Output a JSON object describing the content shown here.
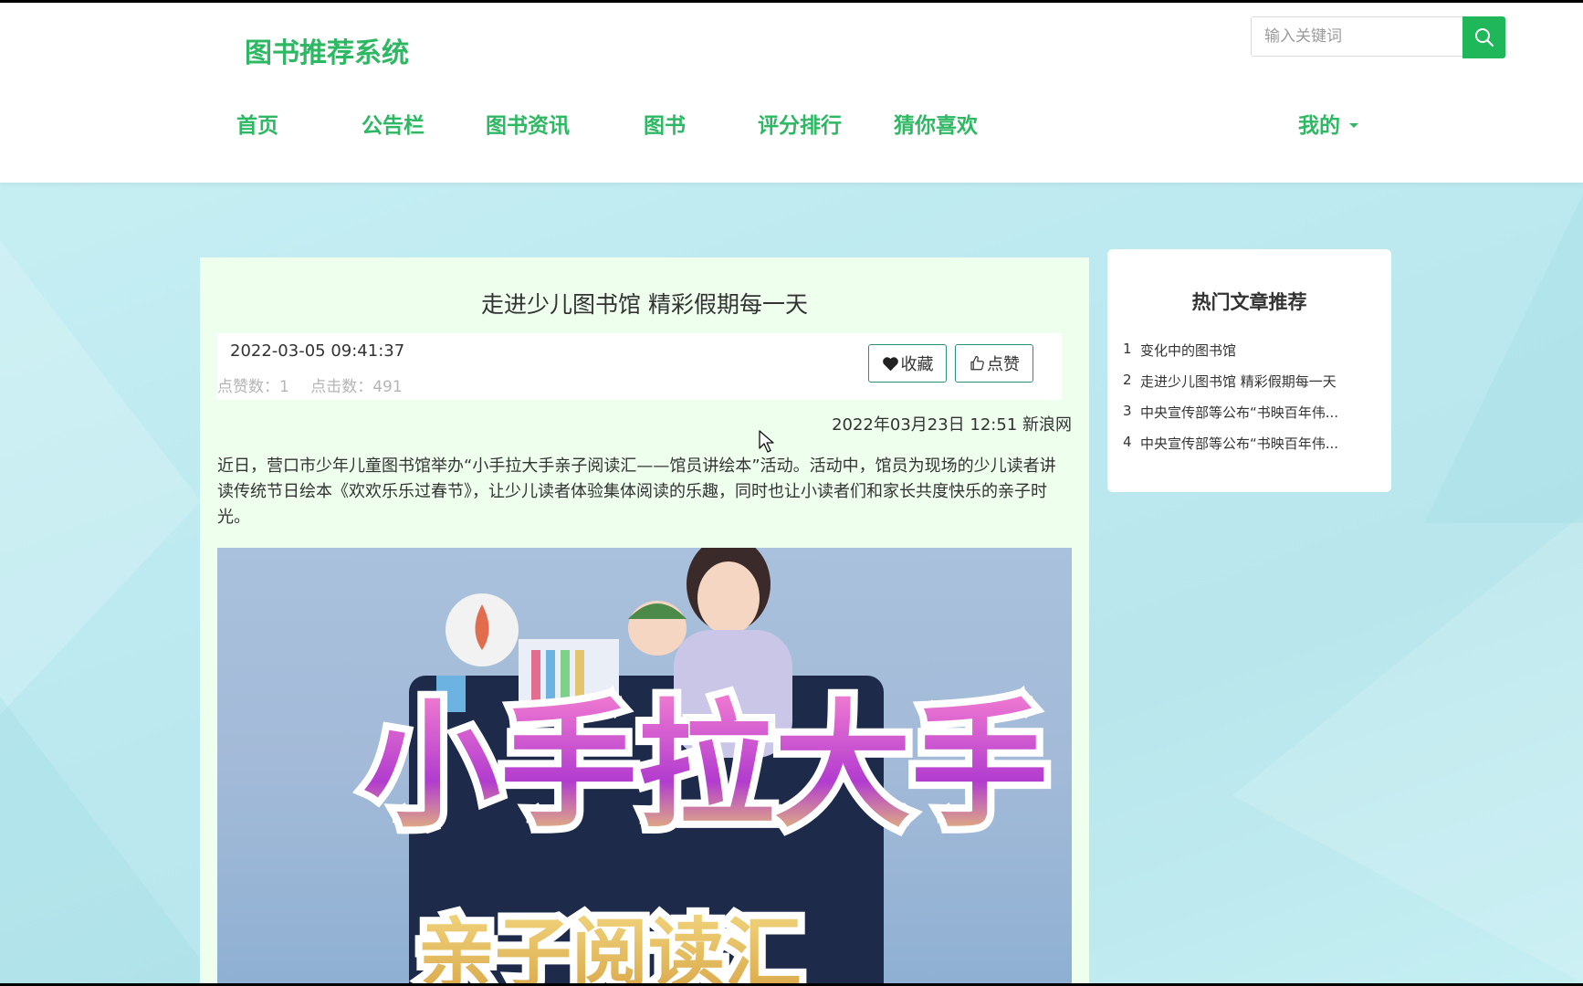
{
  "header": {
    "logo": "图书推荐系统",
    "search": {
      "placeholder": "输入关键词",
      "icon": "search-icon"
    },
    "nav": [
      "首页",
      "公告栏",
      "图书资讯",
      "图书",
      "评分排行",
      "猜你喜欢"
    ],
    "mine": "我的"
  },
  "article": {
    "title": "走进少儿图书馆 精彩假期每一天",
    "datetime": "2022-03-05 09:41:37",
    "likes_label": "点赞数：1",
    "clicks_label": "点击数：491",
    "fav_label": "收藏",
    "like_label": "点赞",
    "source": "2022年03月23日 12:51 新浪网",
    "content": "近日，营口市少年儿童图书馆举办“小手拉大手亲子阅读汇——馆员讲绘本”活动。活动中，馆员为现场的少儿读者讲读传统节日绘本《欢欢乐乐过春节》，让少儿读者体验集体阅读的乐趣，同时也让小读者们和家长共度快乐的亲子时光。",
    "image_text": {
      "line1": "小手拉大手",
      "line2": "亲子阅读汇"
    }
  },
  "sidebar": {
    "title": "热门文章推荐",
    "items": [
      {
        "num": "1",
        "title": "变化中的图书馆"
      },
      {
        "num": "2",
        "title": "走进少儿图书馆 精彩假期每一天"
      },
      {
        "num": "3",
        "title": "中央宣传部等公布“书映百年伟..."
      },
      {
        "num": "4",
        "title": "中央宣传部等公布“书映百年伟..."
      }
    ]
  },
  "colors": {
    "brand": "#2fb864",
    "search_button": "#1fb75a",
    "article_bg": "#efffee"
  }
}
